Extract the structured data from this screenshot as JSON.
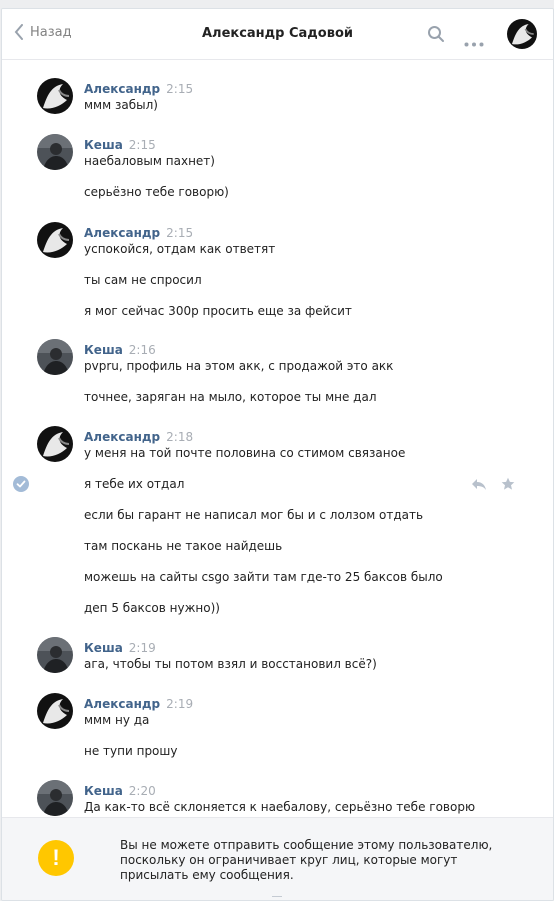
{
  "header": {
    "back_label": "Назад",
    "title": "Александр Садовой"
  },
  "groups": [
    {
      "author": "Александр",
      "time": "2:15",
      "avatar": "alexander",
      "messages": [
        "ммм забыл)"
      ]
    },
    {
      "author": "Кеша",
      "time": "2:15",
      "avatar": "kesha",
      "messages": [
        "наебаловым пахнет)",
        "серьёзно тебе говорю)"
      ]
    },
    {
      "author": "Александр",
      "time": "2:15",
      "avatar": "alexander",
      "messages": [
        "успокойся, отдам как ответят",
        "ты сам не спросил",
        "я мог сейчас 300р просить еще за фейсит"
      ]
    },
    {
      "author": "Кеша",
      "time": "2:16",
      "avatar": "kesha",
      "messages": [
        "pvpru, профиль на этом акк, с продажой это акк",
        "точнее, заряган на мыло, которое ты мне дал"
      ]
    },
    {
      "author": "Александр",
      "time": "2:18",
      "avatar": "alexander",
      "messages": [
        "у меня на той почте половина со стимом связаное",
        "я тебе их отдал",
        "если бы гарант не написал мог бы и с лолзом отдать",
        "там поскань не такое найдешь",
        "можешь на сайты csgo зайти там где-то 25 баксов было",
        "деп 5 баксов нужно))"
      ]
    },
    {
      "author": "Кеша",
      "time": "2:19",
      "avatar": "kesha",
      "messages": [
        "ага, чтобы ты потом взял и восстановил всё?)"
      ]
    },
    {
      "author": "Александр",
      "time": "2:19",
      "avatar": "alexander",
      "messages": [
        "ммм ну да",
        "не тупи прошу"
      ]
    },
    {
      "author": "Кеша",
      "time": "2:20",
      "avatar": "kesha",
      "messages": [
        "Да как-то всё склоняется к наебалову, серьёзно тебе говорю"
      ]
    }
  ],
  "footer": {
    "notice": "Вы не можете отправить сообщение этому пользователю, поскольку он ограничивает круг лиц, которые могут присылать ему сообщения."
  }
}
